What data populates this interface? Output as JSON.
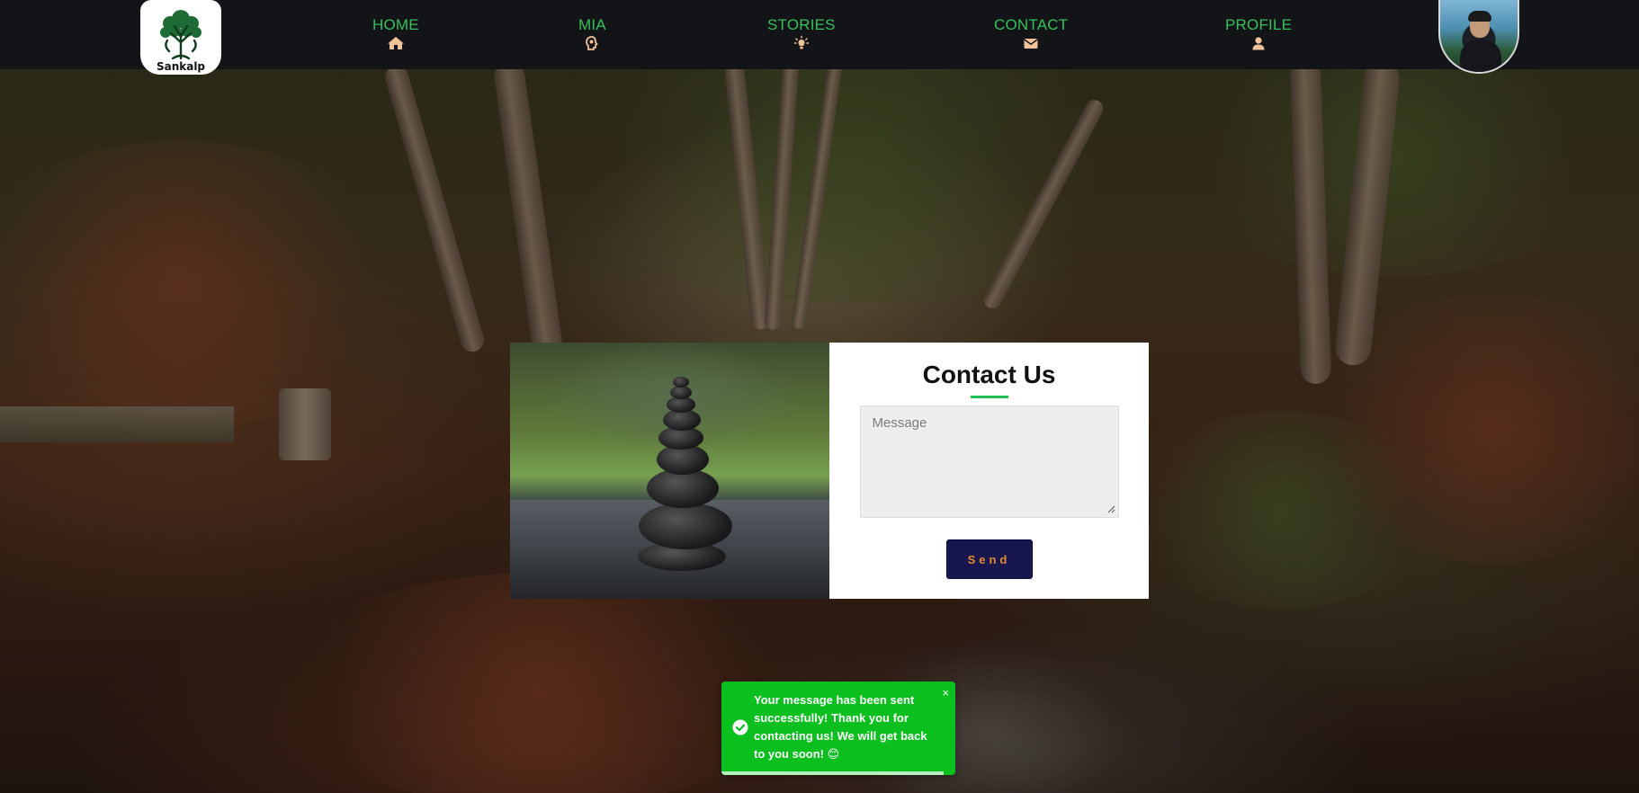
{
  "brand": {
    "name": "Sankalp"
  },
  "nav": {
    "items": [
      {
        "label": "HOME",
        "icon": "home-icon"
      },
      {
        "label": "MIA",
        "icon": "head-bulb-icon"
      },
      {
        "label": "STORIES",
        "icon": "lightbulb-icon"
      },
      {
        "label": "CONTACT",
        "icon": "envelope-icon"
      },
      {
        "label": "PROFILE",
        "icon": "user-icon"
      }
    ],
    "label_color": "#35c15b",
    "icon_color": "#f1c39a",
    "background": "#121418"
  },
  "contact": {
    "title": "Contact Us",
    "message_placeholder": "Message",
    "message_value": "",
    "send_label": "Send",
    "accent": "#1fbf55",
    "button_bg": "#17164f",
    "button_text_color": "#e08a2e"
  },
  "toast": {
    "message": "Your message has been sent successfully! Thank you for contacting us! We will get back to you soon! 😊",
    "close_label": "×",
    "progress": 0.95,
    "background": "#0bbf1f"
  }
}
